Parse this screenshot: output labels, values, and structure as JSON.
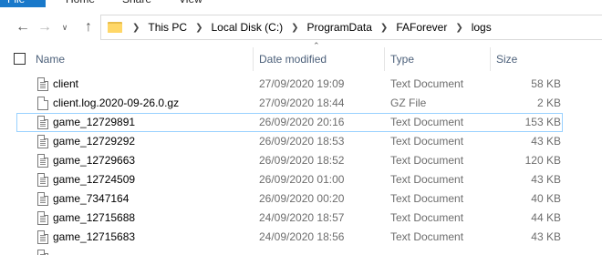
{
  "ribbon": {
    "tabs": [
      "File",
      "Home",
      "Share",
      "View"
    ]
  },
  "nav": {
    "back_icon": "arrow-left-icon",
    "forward_icon": "arrow-right-icon",
    "recent_icon": "chevron-down-icon",
    "up_icon": "arrow-up-icon"
  },
  "address": {
    "crumbs": [
      "This PC",
      "Local Disk (C:)",
      "ProgramData",
      "FAForever",
      "logs"
    ]
  },
  "columns": {
    "name": "Name",
    "date": "Date modified",
    "type": "Type",
    "size": "Size"
  },
  "files": [
    {
      "name": "client",
      "date": "27/09/2020 19:09",
      "type": "Text Document",
      "size": "58 KB",
      "icon": "text-document-icon"
    },
    {
      "name": "client.log.2020-09-26.0.gz",
      "date": "27/09/2020 18:44",
      "type": "GZ File",
      "size": "2 KB",
      "icon": "file-icon"
    },
    {
      "name": "game_12729891",
      "date": "26/09/2020 20:16",
      "type": "Text Document",
      "size": "153 KB",
      "icon": "text-document-icon"
    },
    {
      "name": "game_12729292",
      "date": "26/09/2020 18:53",
      "type": "Text Document",
      "size": "43 KB",
      "icon": "text-document-icon"
    },
    {
      "name": "game_12729663",
      "date": "26/09/2020 18:52",
      "type": "Text Document",
      "size": "120 KB",
      "icon": "text-document-icon"
    },
    {
      "name": "game_12724509",
      "date": "26/09/2020 01:00",
      "type": "Text Document",
      "size": "43 KB",
      "icon": "text-document-icon"
    },
    {
      "name": "game_7347164",
      "date": "26/09/2020 00:20",
      "type": "Text Document",
      "size": "40 KB",
      "icon": "text-document-icon"
    },
    {
      "name": "game_12715688",
      "date": "24/09/2020 18:57",
      "type": "Text Document",
      "size": "44 KB",
      "icon": "text-document-icon"
    },
    {
      "name": "game_12715683",
      "date": "24/09/2020 18:56",
      "type": "Text Document",
      "size": "43 KB",
      "icon": "text-document-icon"
    }
  ],
  "selected_index": 2,
  "colors": {
    "accent": "#1979ca",
    "selection_border": "#99d1ff",
    "header_text": "#4c607a",
    "folder": "#ffd767"
  }
}
